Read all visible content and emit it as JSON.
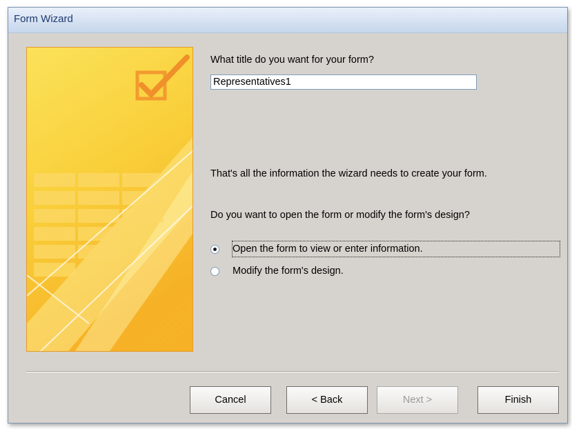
{
  "window": {
    "title": "Form Wizard"
  },
  "question_title": "What title do you want for your form?",
  "title_input": {
    "value": "Representatives1"
  },
  "info_text": "That's all the information the wizard needs to create your form.",
  "question_open": "Do you want to open the form or modify the form's design?",
  "options": [
    {
      "label": "Open the form to view or enter information.",
      "selected": true
    },
    {
      "label": "Modify the form's design.",
      "selected": false
    }
  ],
  "buttons": {
    "cancel": "Cancel",
    "back": "< Back",
    "next": "Next >",
    "finish": "Finish"
  },
  "colors": {
    "banner_top": "#f9d84a",
    "banner_bottom": "#f7b928",
    "banner_border": "#e49a2c",
    "title_text": "#1e3a6e"
  },
  "icons": [
    "checkbox-check-icon",
    "radio-selected-icon",
    "radio-unselected-icon"
  ]
}
